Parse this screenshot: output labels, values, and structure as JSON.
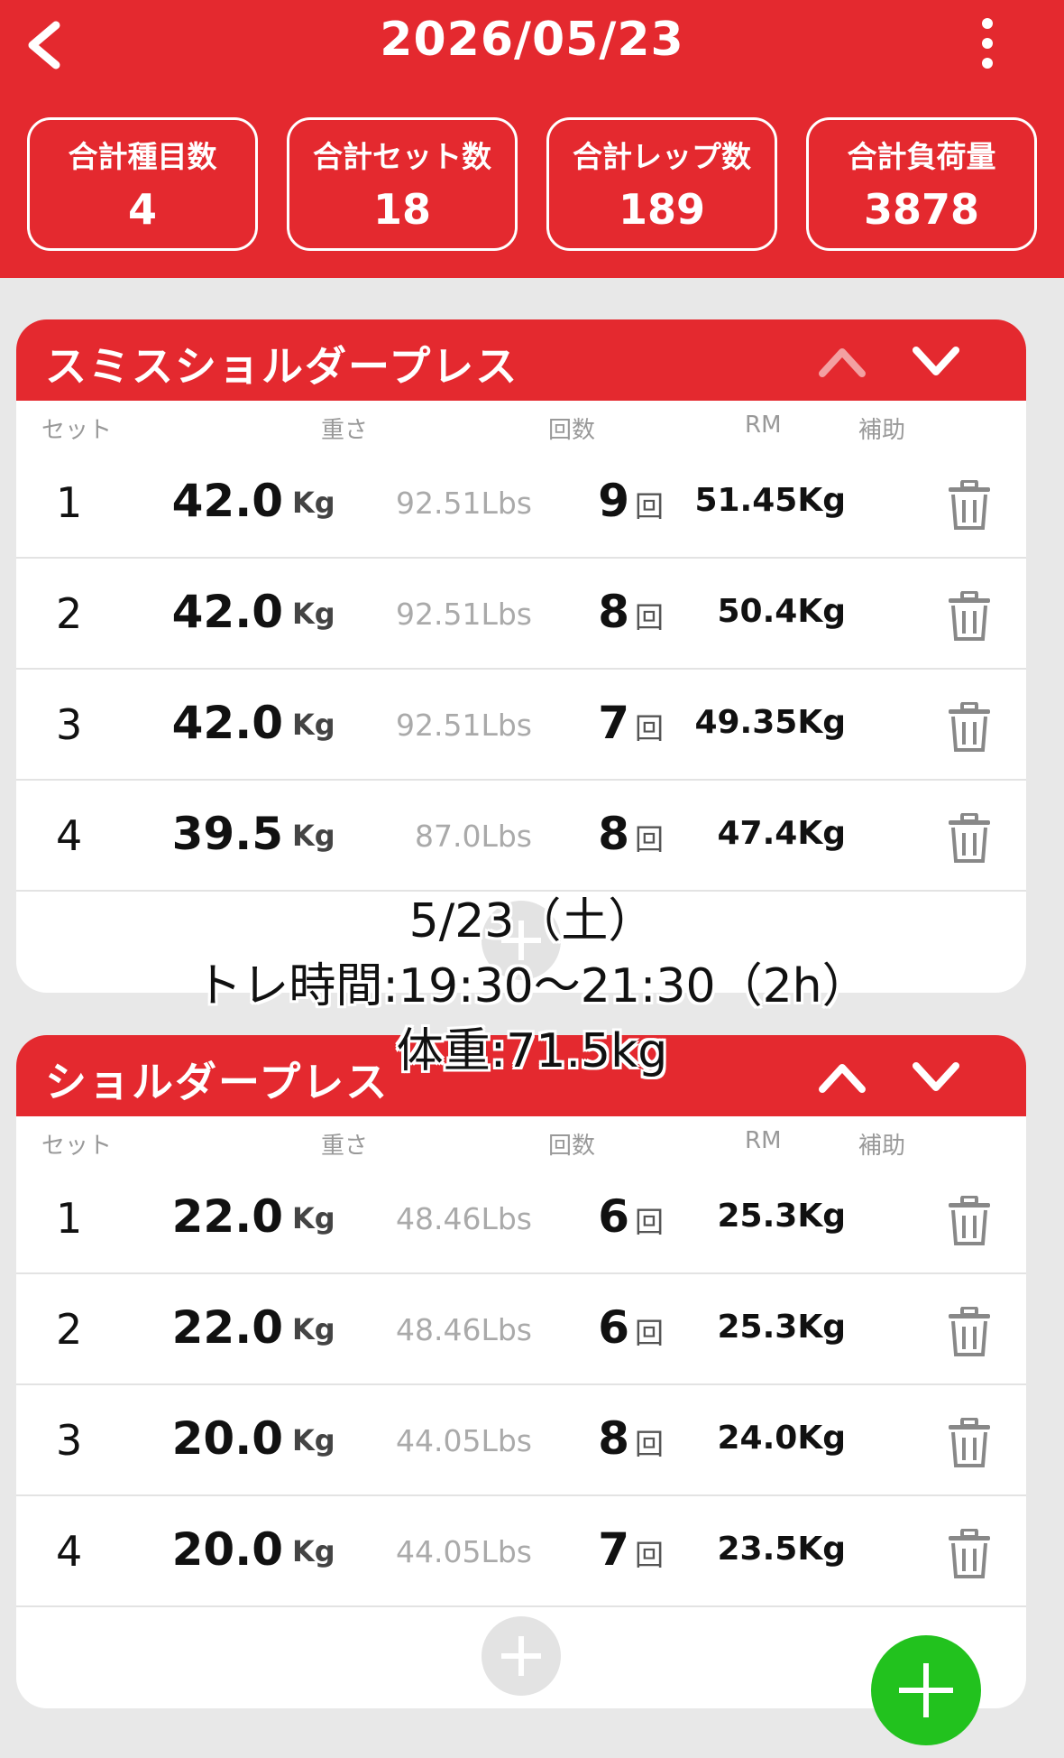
{
  "header": {
    "title": "2026/05/23",
    "stats": [
      {
        "label": "合計種目数",
        "value": "4"
      },
      {
        "label": "合計セット数",
        "value": "18"
      },
      {
        "label": "合計レップ数",
        "value": "189"
      },
      {
        "label": "合計負荷量",
        "value": "3878"
      }
    ]
  },
  "columns": {
    "set": "セット",
    "weight": "重さ",
    "reps": "回数",
    "rm": "RM",
    "assist": "補助"
  },
  "units": {
    "kg": "Kg",
    "rep": "回"
  },
  "exercises": [
    {
      "name": "スミスショルダープレス",
      "sets": [
        {
          "set": "1",
          "kg": "42.0",
          "lbs": "92.51Lbs",
          "reps": "9",
          "rm": "51.45Kg"
        },
        {
          "set": "2",
          "kg": "42.0",
          "lbs": "92.51Lbs",
          "reps": "8",
          "rm": "50.4Kg"
        },
        {
          "set": "3",
          "kg": "42.0",
          "lbs": "92.51Lbs",
          "reps": "7",
          "rm": "49.35Kg"
        },
        {
          "set": "4",
          "kg": "39.5",
          "lbs": "87.0Lbs",
          "reps": "8",
          "rm": "47.4Kg"
        }
      ]
    },
    {
      "name": "ショルダープレス",
      "sets": [
        {
          "set": "1",
          "kg": "22.0",
          "lbs": "48.46Lbs",
          "reps": "6",
          "rm": "25.3Kg"
        },
        {
          "set": "2",
          "kg": "22.0",
          "lbs": "48.46Lbs",
          "reps": "6",
          "rm": "25.3Kg"
        },
        {
          "set": "3",
          "kg": "20.0",
          "lbs": "44.05Lbs",
          "reps": "8",
          "rm": "24.0Kg"
        },
        {
          "set": "4",
          "kg": "20.0",
          "lbs": "44.05Lbs",
          "reps": "7",
          "rm": "23.5Kg"
        }
      ]
    }
  ],
  "overlay": {
    "line1": "5/23（土）",
    "line2": "トレ時間:19:30〜21:30（2h）",
    "line3": "体重:71.5kg"
  },
  "colors": {
    "accent": "#e4292f",
    "fab": "#22c21e"
  }
}
